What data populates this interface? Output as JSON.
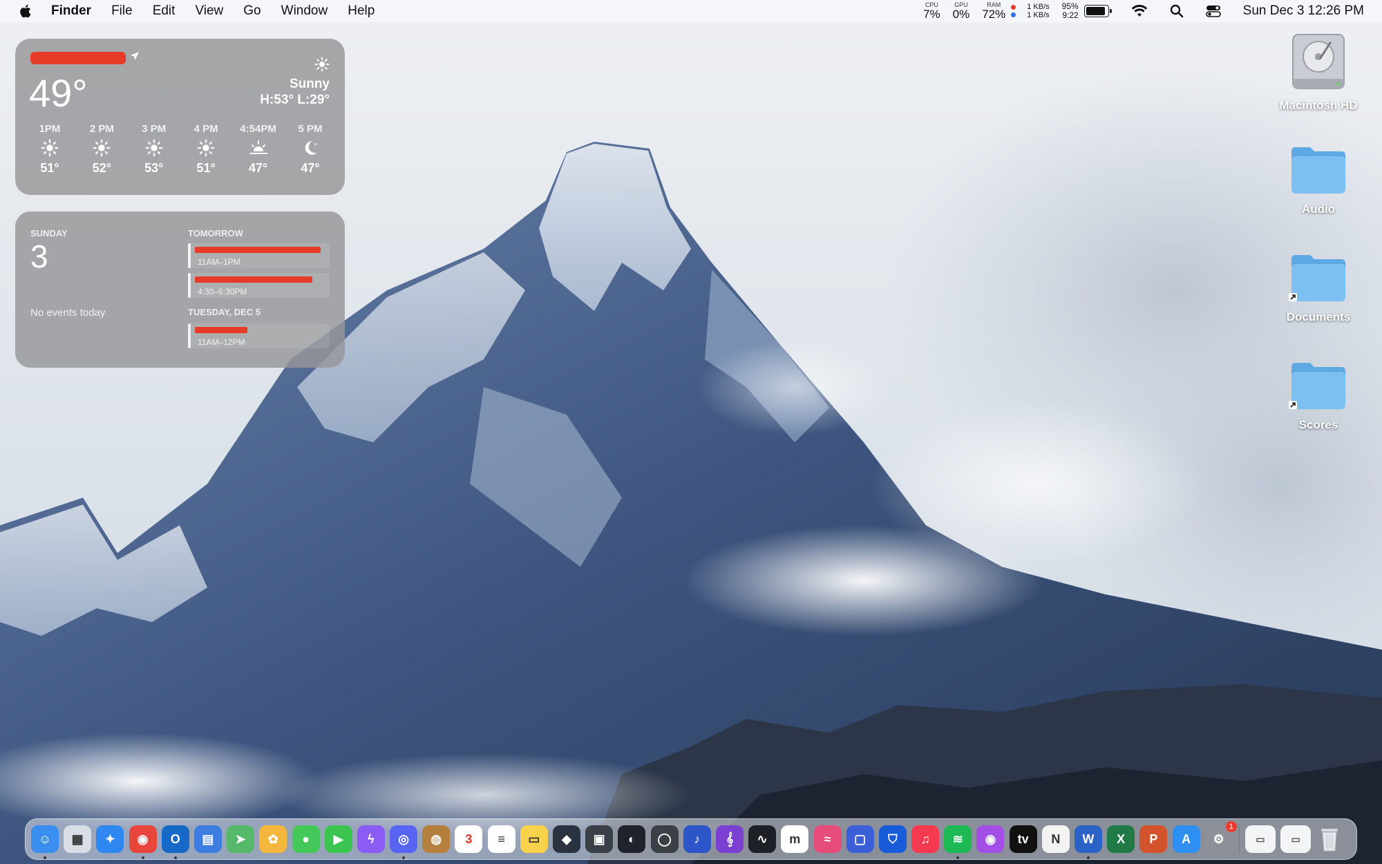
{
  "menubar": {
    "app_name": "Finder",
    "menus": [
      "File",
      "Edit",
      "View",
      "Go",
      "Window",
      "Help"
    ],
    "cpu": {
      "label": "CPU",
      "value": "7%"
    },
    "gpu": {
      "label": "GPU",
      "value": "0%"
    },
    "ram": {
      "label": "RAM",
      "value": "72%"
    },
    "net": {
      "up": "1 KB/s",
      "down": "1 KB/s"
    },
    "battery": {
      "percent": "95%",
      "time": "9:22",
      "level": 0.95
    },
    "clock": "Sun Dec 3  12:26 PM"
  },
  "weather": {
    "temp": "49°",
    "condition": "Sunny",
    "hilo": "H:53° L:29°",
    "hours": [
      {
        "time": "1PM",
        "icon": "sun-icon",
        "temp": "51°"
      },
      {
        "time": "2 PM",
        "icon": "sun-icon",
        "temp": "52°"
      },
      {
        "time": "3 PM",
        "icon": "sun-icon",
        "temp": "53°"
      },
      {
        "time": "4 PM",
        "icon": "sun-icon",
        "temp": "51°"
      },
      {
        "time": "4:54PM",
        "icon": "sunset-icon",
        "temp": "47°"
      },
      {
        "time": "5 PM",
        "icon": "moon-icon",
        "temp": "47°"
      }
    ]
  },
  "calendar": {
    "weekday": "SUNDAY",
    "date": "3",
    "no_events": "No events today",
    "tomorrow_label": "TOMORROW",
    "tuesday_label": "TUESDAY, DEC 5",
    "events": [
      {
        "time": "11AM–1PM"
      },
      {
        "time": "4:30–6:30PM"
      },
      {
        "time": "11AM–12PM"
      }
    ]
  },
  "desktop": {
    "icons": [
      {
        "label": "Macintosh HD",
        "icon": "hard-drive-icon"
      },
      {
        "label": "Audio",
        "icon": "folder-icon"
      },
      {
        "label": "Documents",
        "icon": "folder-alias-icon"
      },
      {
        "label": "Scores",
        "icon": "folder-alias-icon"
      }
    ]
  },
  "dock": {
    "apps": [
      {
        "name": "finder",
        "color": "#3a8ef0",
        "glyph": "☺"
      },
      {
        "name": "launchpad",
        "color": "#d9dde5",
        "glyph": "▦"
      },
      {
        "name": "safari",
        "color": "#2f88f2",
        "glyph": "✦"
      },
      {
        "name": "chrome",
        "color": "#e8453c",
        "glyph": "◉"
      },
      {
        "name": "outlook",
        "color": "#1669c7",
        "glyph": "O"
      },
      {
        "name": "files",
        "color": "#3e7de0",
        "glyph": "▤"
      },
      {
        "name": "maps",
        "color": "#55b86a",
        "glyph": "➤"
      },
      {
        "name": "photos",
        "color": "#f4b63c",
        "glyph": "✿"
      },
      {
        "name": "messages",
        "color": "#45c85a",
        "glyph": "●"
      },
      {
        "name": "facetime",
        "color": "#3cc451",
        "glyph": "▶"
      },
      {
        "name": "messenger",
        "color": "#8a5cf4",
        "glyph": "ϟ"
      },
      {
        "name": "discord",
        "color": "#5865f2",
        "glyph": "◎"
      },
      {
        "name": "contacts",
        "color": "#b5803e",
        "glyph": "◍"
      },
      {
        "name": "calendar",
        "color": "#ffffff",
        "glyph": "3"
      },
      {
        "name": "reminders",
        "color": "#ffffff",
        "glyph": "≡"
      },
      {
        "name": "notes",
        "color": "#f7d24a",
        "glyph": "▭"
      },
      {
        "name": "davinci",
        "color": "#2c3340",
        "glyph": "◆"
      },
      {
        "name": "compressor",
        "color": "#3a3f48",
        "glyph": "▣"
      },
      {
        "name": "obs",
        "color": "#20232b",
        "glyph": "◐"
      },
      {
        "name": "logic",
        "color": "#3b3f46",
        "glyph": "◯"
      },
      {
        "name": "audio-app",
        "color": "#2b55c9",
        "glyph": "♪"
      },
      {
        "name": "musescore",
        "color": "#7b3fd1",
        "glyph": "𝄞"
      },
      {
        "name": "activity",
        "color": "#1d2026",
        "glyph": "∿"
      },
      {
        "name": "m-app",
        "color": "#ffffff",
        "glyph": "m"
      },
      {
        "name": "waveform",
        "color": "#e64d7a",
        "glyph": "≈"
      },
      {
        "name": "screens",
        "color": "#3a5fd6",
        "glyph": "▢"
      },
      {
        "name": "bitwarden",
        "color": "#185bd8",
        "glyph": "⛉"
      },
      {
        "name": "music",
        "color": "#f5394e",
        "glyph": "♫"
      },
      {
        "name": "spotify",
        "color": "#1db954",
        "glyph": "≋"
      },
      {
        "name": "podcasts",
        "color": "#a34ee6",
        "glyph": "◉"
      },
      {
        "name": "tv",
        "color": "#111111",
        "glyph": "tv"
      },
      {
        "name": "news",
        "color": "#f2f2f2",
        "glyph": "N"
      },
      {
        "name": "word",
        "color": "#2b62c5",
        "glyph": "W"
      },
      {
        "name": "excel",
        "color": "#1f7a45",
        "glyph": "X"
      },
      {
        "name": "powerpoint",
        "color": "#d2532c",
        "glyph": "P"
      },
      {
        "name": "app-store",
        "color": "#2e8ff0",
        "glyph": "A"
      },
      {
        "name": "system-settings",
        "color": "#8d9099",
        "glyph": "⚙"
      }
    ],
    "settings_badge": "1",
    "running": [
      "finder",
      "chrome",
      "outlook",
      "discord",
      "spotify",
      "word"
    ]
  }
}
